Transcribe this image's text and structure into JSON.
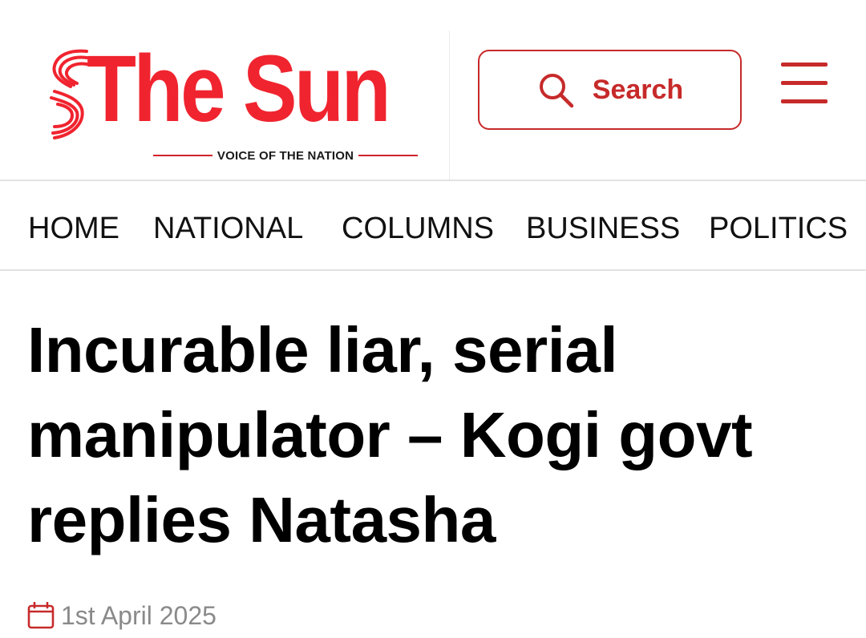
{
  "brand": {
    "name": "The Sun",
    "tagline": "VOICE OF THE NATION",
    "color": "#f0242f"
  },
  "header": {
    "search_label": "Search",
    "search_icon": "search-icon",
    "menu_icon": "hamburger-menu-icon",
    "accent_color": "#c72a2a"
  },
  "nav": {
    "items": [
      {
        "label": "HOME"
      },
      {
        "label": "NATIONAL"
      },
      {
        "label": "COLUMNS"
      },
      {
        "label": "BUSINESS"
      },
      {
        "label": "POLITICS"
      }
    ]
  },
  "article": {
    "headline": "Incurable liar, serial manipulator – Kogi govt replies Natasha",
    "date": "1st April 2025",
    "date_icon": "calendar-icon",
    "date_icon_color": "#c72a2a"
  }
}
